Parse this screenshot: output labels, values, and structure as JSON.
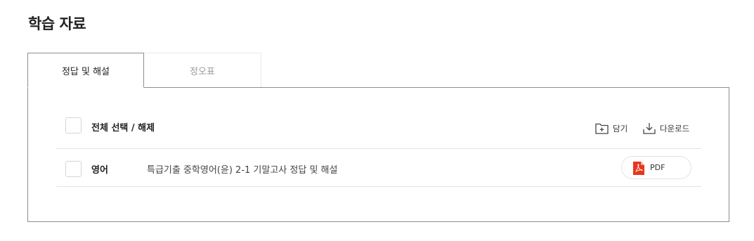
{
  "page": {
    "title": "학습 자료"
  },
  "tabs": [
    {
      "label": "정답 및 해설",
      "active": true
    },
    {
      "label": "정오표",
      "active": false
    }
  ],
  "list": {
    "select_all_label": "전체 선택 / 해제",
    "actions": {
      "save_label": "담기",
      "download_label": "다운로드"
    },
    "items": [
      {
        "language": "영어",
        "title": "특급기출 중학영어(윤) 2-1 기말고사 정답 및 해설",
        "file_type": "PDF"
      }
    ]
  },
  "colors": {
    "pdf_icon": "#e8361e",
    "active_border": "#8e8e8e",
    "divider": "#e3e3e3"
  }
}
